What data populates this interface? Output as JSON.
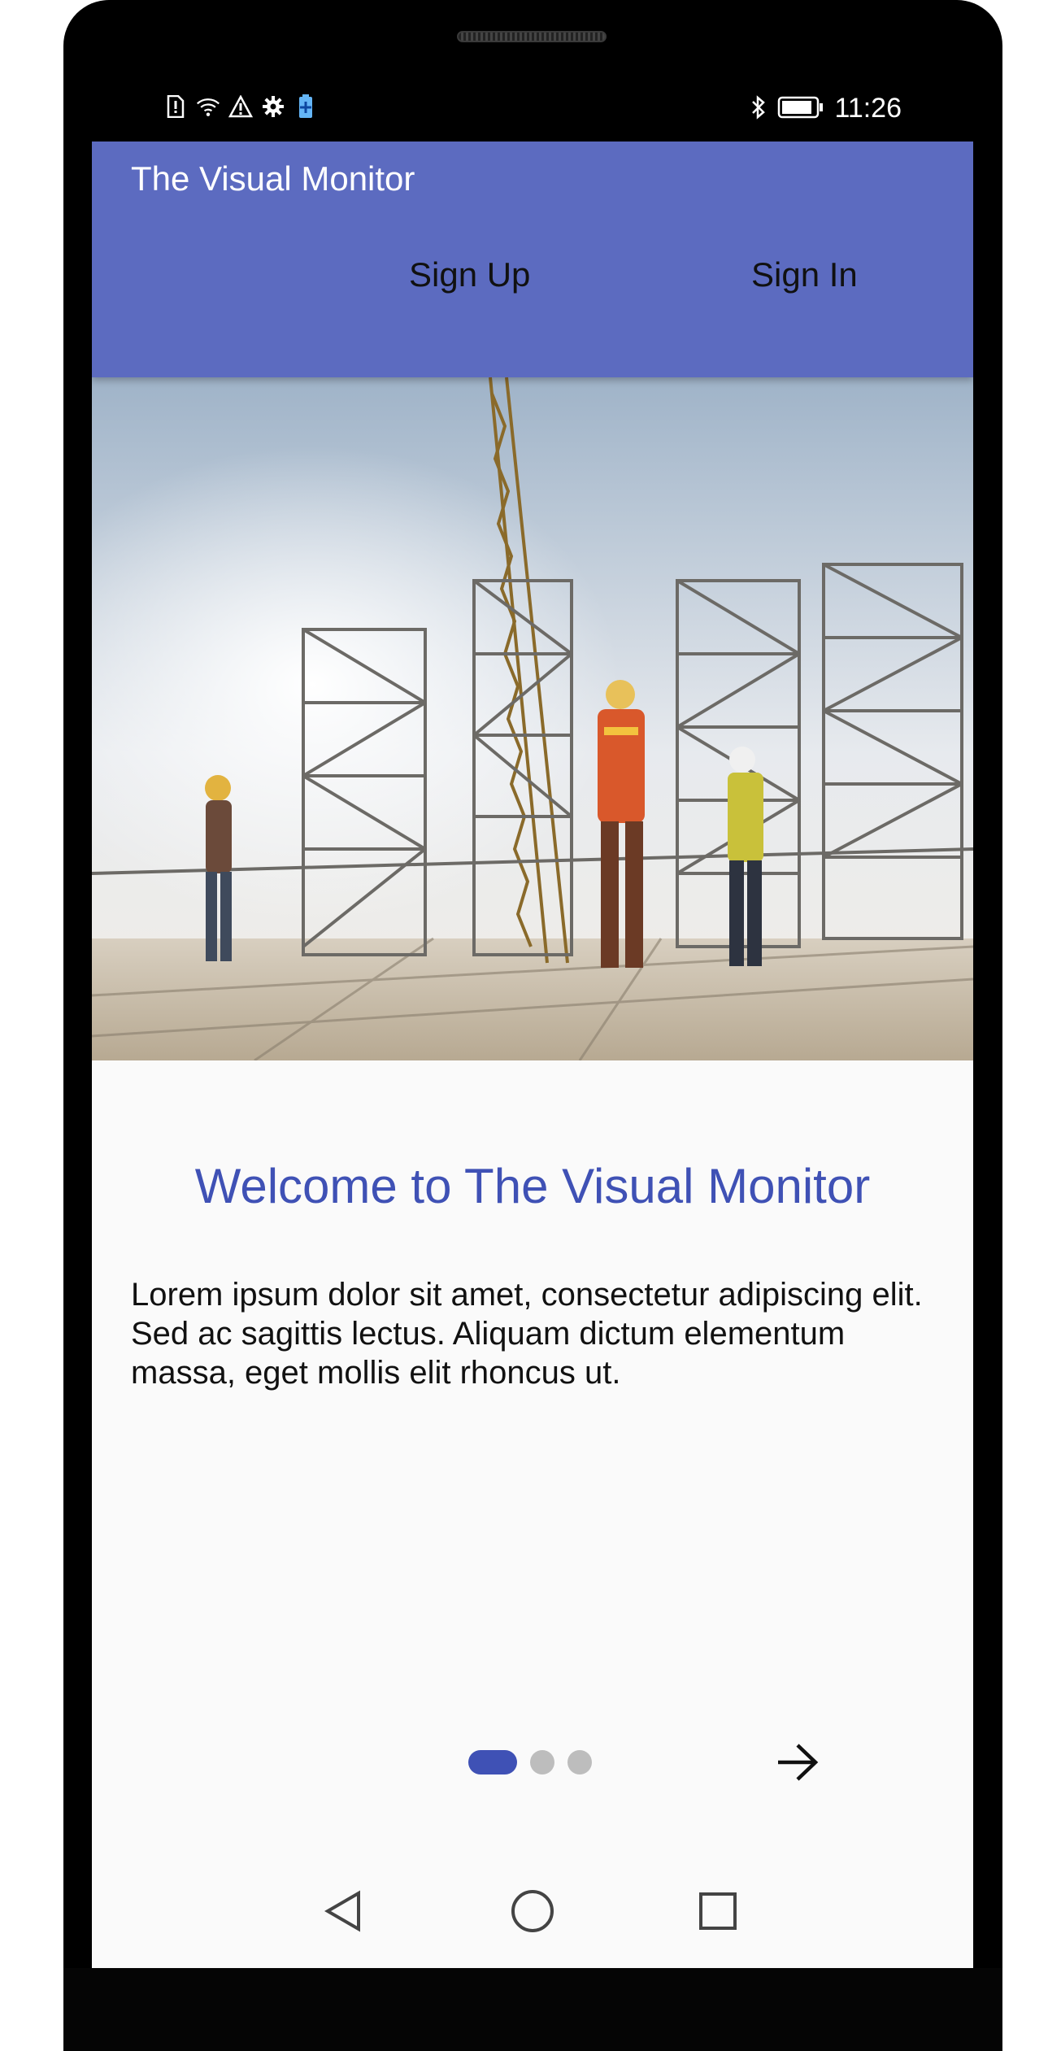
{
  "status_bar": {
    "time": "11:26",
    "left_icons": [
      "sim-alert-icon",
      "wifi-icon",
      "warning-icon",
      "gear-icon",
      "battery-saver-icon"
    ],
    "right_icons": [
      "bluetooth-icon",
      "battery-icon"
    ]
  },
  "app_bar": {
    "title": "The Visual Monitor",
    "tabs": [
      {
        "label": "Sign Up"
      },
      {
        "label": "Sign In"
      }
    ],
    "color": "#5c6bc0"
  },
  "hero": {
    "image": "construction-workers-scaffolding-image"
  },
  "content": {
    "heading": "Welcome to The Visual Monitor",
    "body": "Lorem ipsum dolor sit amet, consectetur adipiscing elit. Sed ac sagittis lectus. Aliquam dictum elementum massa, eget mollis elit rhoncus ut.",
    "heading_color": "#3f51b5"
  },
  "pager": {
    "pages": 3,
    "current": 1,
    "next_icon": "arrow-right-icon"
  },
  "nav_bar": {
    "icons": [
      "back-triangle-icon",
      "home-circle-icon",
      "recents-square-icon"
    ]
  }
}
